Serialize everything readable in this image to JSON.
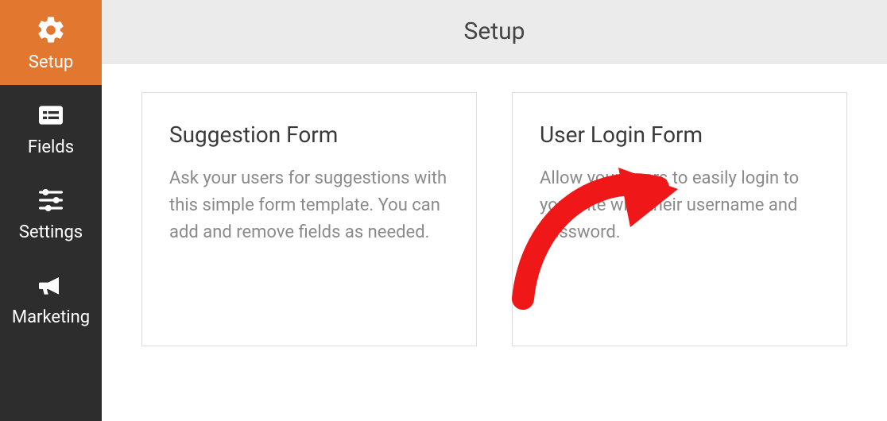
{
  "sidebar": {
    "items": [
      {
        "label": "Setup"
      },
      {
        "label": "Fields"
      },
      {
        "label": "Settings"
      },
      {
        "label": "Marketing"
      }
    ]
  },
  "topbar": {
    "title": "Setup"
  },
  "cards": [
    {
      "title": "Suggestion Form",
      "desc": "Ask your users for suggestions with this simple form template. You can add and remove fields as needed."
    },
    {
      "title": "User Login Form",
      "desc": "Allow your users to easily login to your site with their username and password."
    }
  ]
}
